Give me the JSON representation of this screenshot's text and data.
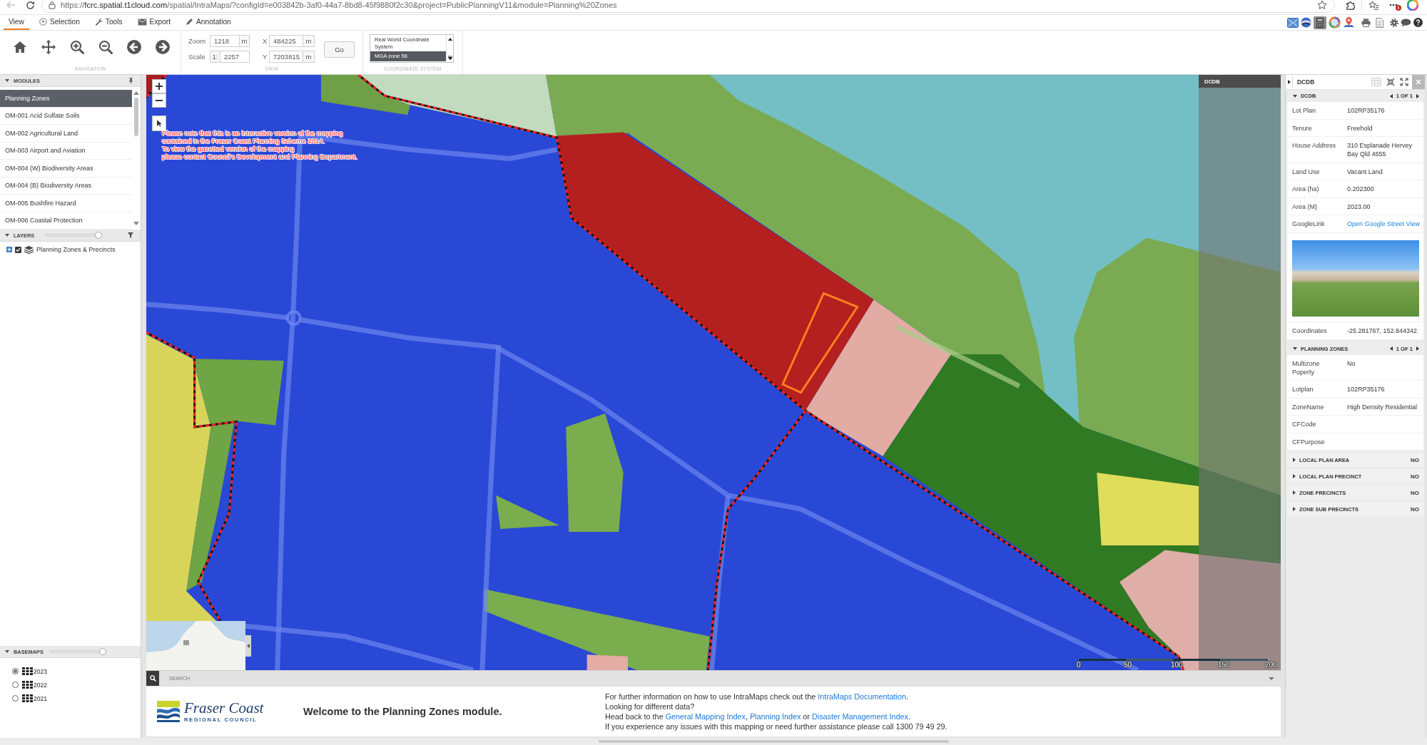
{
  "browser": {
    "url": {
      "scheme": "https://",
      "host": "fcrc.spatial.t1cloud.com",
      "path": "/spatial/IntraMaps/?configId=e003842b-3af0-44a7-8bd8-45f9880f2c30&project=PublicPlanningV11&module=Planning%20Zones"
    }
  },
  "menu_tabs": [
    {
      "label": "View",
      "selected": true
    },
    {
      "label": "Selection",
      "selected": false
    },
    {
      "label": "Tools",
      "selected": false
    },
    {
      "label": "Export",
      "selected": false
    },
    {
      "label": "Annotation",
      "selected": false
    }
  ],
  "toolbar": {
    "navigation": {
      "label": "NAVIGATION"
    },
    "view": {
      "label": "VIEW",
      "zoom": {
        "label": "Zoom",
        "value": "1218",
        "unit": "m"
      },
      "scale": {
        "label": "Scale",
        "prefix": "1:",
        "value": "2257"
      },
      "x": {
        "label": "X",
        "value": "484225",
        "unit": "m"
      },
      "y": {
        "label": "Y",
        "value": "7203815",
        "unit": "m"
      },
      "go_button": "Go"
    },
    "coordinate_system": {
      "label": "COORDINATE SYSTEM",
      "options": [
        {
          "label": "Real World Coordinate System",
          "selected": false
        },
        {
          "label": "MGA zone 56",
          "selected": true
        }
      ]
    }
  },
  "modules": {
    "title": "MODULES",
    "items": [
      {
        "label": "Planning Zones",
        "selected": true
      },
      {
        "label": "OM-001 Acid Sulfate Soils",
        "selected": false
      },
      {
        "label": "OM-002 Agricultural Land",
        "selected": false
      },
      {
        "label": "OM-003 Airport and Aviation",
        "selected": false
      },
      {
        "label": "OM-004 (W) Biodiversity Areas",
        "selected": false
      },
      {
        "label": "OM-004 (B) Biodiversity Areas",
        "selected": false
      },
      {
        "label": "OM-005 Bushfire Hazard",
        "selected": false
      },
      {
        "label": "OM-006 Coastal Protection",
        "selected": false
      }
    ]
  },
  "layers": {
    "title": "LAYERS",
    "level": 1,
    "items": [
      {
        "label": "Planning Zones & Precincts",
        "checked": true,
        "expanded": false
      }
    ]
  },
  "basemaps": {
    "title": "BASEMAPS",
    "level": 1,
    "items": [
      {
        "label": "2023",
        "selected": true
      },
      {
        "label": "2022",
        "selected": false
      },
      {
        "label": "2021",
        "selected": false
      }
    ]
  },
  "map": {
    "notice": [
      "Please note that this is an interactive version of the mapping",
      "contained in the Fraser Coast Planning Scheme 2014.",
      "To view the gazetted version of the mapping",
      "please contact Council's Development and Planning Department."
    ],
    "overlay_panel": {
      "title": "DCDB"
    },
    "scale_bar": {
      "labels": [
        "0",
        "50",
        "100",
        "150",
        "200"
      ]
    }
  },
  "search": {
    "label": "SEARCH"
  },
  "welcome": {
    "logo": {
      "name": "Fraser Coast",
      "subtitle": "REGIONAL COUNCIL"
    },
    "heading": "Welcome to the Planning Zones module.",
    "info_lines": [
      {
        "segments": [
          {
            "kind": "text",
            "text": "For further information on how to use IntraMaps check out the "
          },
          {
            "kind": "link",
            "text": "IntraMaps Documentation"
          },
          {
            "kind": "text",
            "text": "."
          }
        ]
      },
      {
        "segments": [
          {
            "kind": "text",
            "text": "Looking for different data?"
          }
        ]
      },
      {
        "segments": [
          {
            "kind": "text",
            "text": "Head back to the "
          },
          {
            "kind": "link",
            "text": "General Mapping Index"
          },
          {
            "kind": "text",
            "text": ", "
          },
          {
            "kind": "link",
            "text": "Planning Index"
          },
          {
            "kind": "text",
            "text": " or "
          },
          {
            "kind": "link",
            "text": "Disaster Management Index"
          },
          {
            "kind": "text",
            "text": "."
          }
        ]
      },
      {
        "segments": [
          {
            "kind": "text",
            "text": "If you experience any issues with this mapping or need further assistance please call 1300 79 49 29."
          }
        ]
      }
    ]
  },
  "info_panel": {
    "title": "DCDB",
    "sections": [
      {
        "title": "DCDB",
        "pager": "1 OF 1",
        "expanded": true,
        "rows": [
          {
            "kind": "text",
            "label": "Lot Plan",
            "value": "102RP35176"
          },
          {
            "kind": "text",
            "label": "Tenure",
            "value": "Freehold"
          },
          {
            "kind": "text",
            "label": "House Address",
            "value": "310 Esplanade Hervey Bay Qld 4655"
          },
          {
            "kind": "text",
            "label": "Land Use",
            "value": "Vacant Land"
          },
          {
            "kind": "text",
            "label": "Area (ha)",
            "value": "0.202300"
          },
          {
            "kind": "text",
            "label": "Area (M)",
            "value": "2023.00"
          },
          {
            "kind": "link",
            "label": "GoogleLink",
            "value": "Open Google Street View"
          },
          {
            "kind": "photo"
          },
          {
            "kind": "text",
            "label": "Coordinates",
            "value": "-25.281767, 152.844342"
          }
        ]
      },
      {
        "title": "PLANNING ZONES",
        "pager": "1 OF 1",
        "expanded": true,
        "rows": [
          {
            "kind": "text",
            "label": "Multizone Poperty",
            "value": "No"
          },
          {
            "kind": "text",
            "label": "Lotplan",
            "value": "102RP35176"
          },
          {
            "kind": "text",
            "label": "ZoneName",
            "value": "High Density Residential"
          },
          {
            "kind": "text",
            "label": "CFCode"
          },
          {
            "kind": "text",
            "label": "CFPurpose"
          }
        ]
      },
      {
        "title": "LOCAL PLAN AREA",
        "value": "NO",
        "expanded": false
      },
      {
        "title": "LOCAL PLAN PRECINCT",
        "value": "NO",
        "expanded": false
      },
      {
        "title": "ZONE PRECINCTS",
        "value": "NO",
        "expanded": false
      },
      {
        "title": "ZONE SUB PRECINCTS",
        "value": "NO",
        "expanded": false
      }
    ]
  }
}
